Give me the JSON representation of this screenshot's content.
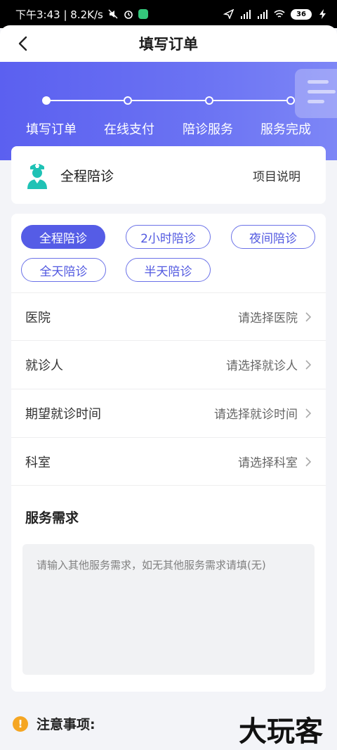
{
  "status_bar": {
    "time_info": "下午3:43 | 8.2K/s",
    "battery": "36"
  },
  "navbar": {
    "title": "填写订单"
  },
  "steps": [
    {
      "label": "填写订单",
      "active": true
    },
    {
      "label": "在线支付",
      "active": false
    },
    {
      "label": "陪诊服务",
      "active": false
    },
    {
      "label": "服务完成",
      "active": false
    }
  ],
  "service_card": {
    "name": "全程陪诊",
    "link": "项目说明"
  },
  "tags": [
    {
      "label": "全程陪诊",
      "selected": true
    },
    {
      "label": "2小时陪诊",
      "selected": false
    },
    {
      "label": "夜间陪诊",
      "selected": false
    },
    {
      "label": "全天陪诊",
      "selected": false
    },
    {
      "label": "半天陪诊",
      "selected": false
    }
  ],
  "rows": [
    {
      "label": "医院",
      "value": "请选择医院"
    },
    {
      "label": "就诊人",
      "value": "请选择就诊人"
    },
    {
      "label": "期望就诊时间",
      "value": "请选择就诊时间"
    },
    {
      "label": "科室",
      "value": "请选择科室"
    }
  ],
  "demand": {
    "title": "服务需求",
    "placeholder": "请输入其他服务需求，如无其他服务需求请填(无)"
  },
  "notice": {
    "icon": "!",
    "text": "注意事项:"
  },
  "watermark": "大玩客",
  "colors": {
    "primary": "#555ce6",
    "hero_start": "#5b60f0",
    "warning": "#f5a623",
    "nurse": "#1fc2b5"
  }
}
